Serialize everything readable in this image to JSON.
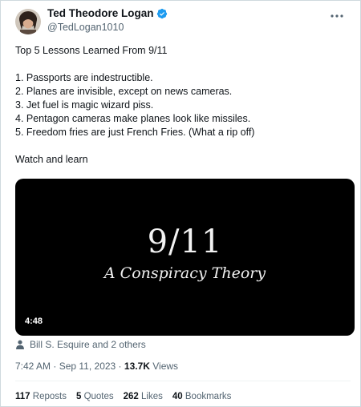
{
  "author": {
    "display_name": "Ted Theodore Logan",
    "handle": "@TedLogan1010"
  },
  "tweet": {
    "title_line": "Top 5 Lessons Learned From 9/11",
    "items": [
      "1. Passports are indestructible.",
      "2. Planes are invisible, except on news cameras.",
      "3. Jet fuel is magic wizard piss.",
      "4. Pentagon cameras make planes look like missiles.",
      "5. Freedom fries are just French Fries. (What a rip off)"
    ],
    "closing": "Watch and learn"
  },
  "video": {
    "title": "9/11",
    "subtitle": "A Conspiracy Theory",
    "duration": "4:48"
  },
  "tagged": "Bill S. Esquire and 2 others",
  "meta": {
    "time": "7:42 AM",
    "separator": " · ",
    "date": "Sep 11, 2023",
    "views_count": "13.7K",
    "views_label": "Views"
  },
  "stats": {
    "reposts_count": "117",
    "reposts_label": "Reposts",
    "quotes_count": "5",
    "quotes_label": "Quotes",
    "likes_count": "262",
    "likes_label": "Likes",
    "bookmarks_count": "40",
    "bookmarks_label": "Bookmarks"
  },
  "colors": {
    "verified_blue": "#1d9bf0",
    "secondary_text": "#536471"
  }
}
